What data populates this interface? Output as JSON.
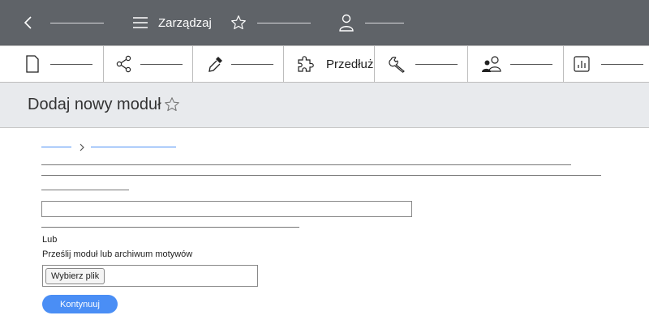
{
  "topbar": {
    "manage_label": "Zarządzaj"
  },
  "toolbar": {
    "extend_label": "Przedłuż"
  },
  "page": {
    "title": "Dodaj nowy moduł"
  },
  "form": {
    "or_label": "Lub",
    "upload_label": "Prześlij moduł lub archiwum motywów",
    "choose_file_label": "Wybierz plik",
    "continue_label": "Kontynuuj"
  },
  "colors": {
    "topbar_bg": "#5f6368",
    "header_bg": "#e8eaed",
    "accent": "#4a8ef5"
  }
}
